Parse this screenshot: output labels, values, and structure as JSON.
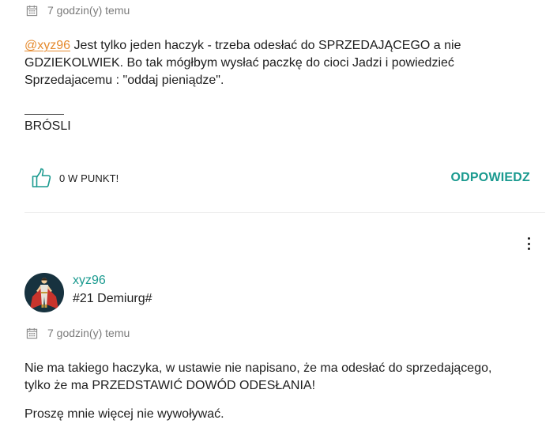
{
  "comment1": {
    "time": "7 godzin(y) temu",
    "mention": "@xyz96",
    "text": " Jest tylko jeden haczyk - trzeba odesłać do SPRZEDAJĄCEGO a nie GDZIEKOLWIEK. Bo tak mógłbym wysłać paczkę do cioci Jadzi i powiedzieć Sprzedajacemu : \"oddaj pieniądze\".",
    "signature": "BRÓSLI",
    "points_label": "0 W PUNKT!",
    "reply_label": "ODPOWIEDZ"
  },
  "comment2": {
    "username": "xyz96",
    "rank": "#21 Demiurg#",
    "time": "7 godzin(y) temu",
    "paragraph1": "Nie ma takiego haczyka, w ustawie nie napisano, że ma odesłać do sprzedającego, tylko że ma PRZEDSTAWIĆ DOWÓD ODESŁANIA!",
    "paragraph2": "Proszę mnie więcej nie wywoływać."
  },
  "colors": {
    "accent": "#1a9a8f",
    "mention": "#e58a2e",
    "avatar_bg": "#17323f"
  }
}
